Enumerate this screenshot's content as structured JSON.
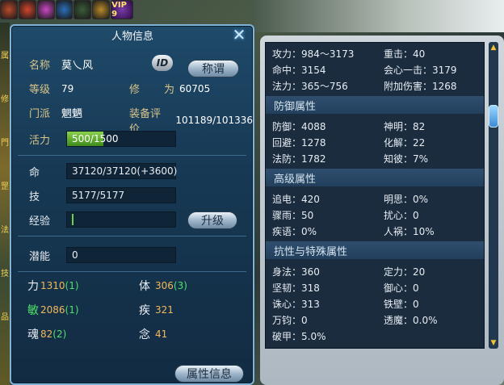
{
  "buffs": [
    {
      "icon": "red-demon-icon",
      "color": "#b84a2a"
    },
    {
      "icon": "fire-icon",
      "color": "#d0452c"
    },
    {
      "icon": "pink-gem-icon",
      "color": "#c848c2"
    },
    {
      "icon": "blue-wings-icon",
      "color": "#2a6fb8"
    },
    {
      "icon": "bird-icon",
      "color": "#3a5c3a"
    },
    {
      "icon": "gold-orb-icon",
      "color": "#b88a2a"
    }
  ],
  "vip_label": "VIP 9",
  "side_glyphs": [
    "属",
    "修",
    "門",
    "罡",
    "法",
    "技",
    "品"
  ],
  "panel": {
    "title": "人物信息",
    "close_glyph": "✕",
    "name_label": "名称",
    "name_value": "莫乀风",
    "id_badge": "ID",
    "title_button": "称谓",
    "level_label": "等级",
    "level_value": "79",
    "cultivation_label": "修",
    "cultivation_label2": "为",
    "cultivation_value": "60705",
    "sect_label": "门派",
    "sect_value": "魍魉",
    "equip_label": "装备评价",
    "equip_value": "101189/101336",
    "vitality_label": "活力",
    "vitality_value": "500/1500",
    "vitality_fraction": 0.333,
    "life_label": "命",
    "life_value": "37120/37120(+3600)",
    "skill_label": "技",
    "skill_value": "5177/5177",
    "exp_label": "经验",
    "exp_value": "",
    "upgrade_button": "升级",
    "potential_label": "潜能",
    "potential_value": "0",
    "attrs": [
      {
        "label": "力",
        "value": "1310",
        "bonus": "(1)",
        "label_color": "#e8edf3"
      },
      {
        "label": "体",
        "value": "306",
        "bonus": "(3)",
        "label_color": "#e8edf3"
      },
      {
        "label": "敏",
        "value": "2086",
        "bonus": "(1)",
        "label_color": "#4fe06a"
      },
      {
        "label": "疾",
        "value": "321",
        "bonus": "",
        "label_color": "#e8edf3"
      },
      {
        "label": "魂",
        "value": "82",
        "bonus": "(2)",
        "label_color": "#e8edf3"
      },
      {
        "label": "念",
        "value": "41",
        "bonus": "",
        "label_color": "#e8edf3"
      }
    ],
    "attr_info_button": "属性信息"
  },
  "right": {
    "top_rows": [
      {
        "l": "攻力：984～3173",
        "r": "重击：40"
      },
      {
        "l": "命中：3154",
        "r": "会心一击：3179"
      },
      {
        "l": "法力：365～756",
        "r": "附加伤害：1268"
      }
    ],
    "sections": [
      {
        "title": "防御属性",
        "rows": [
          {
            "l": "防御：4088",
            "r": "神明：82"
          },
          {
            "l": "回避：1278",
            "r": "化解：22"
          },
          {
            "l": "法防：1782",
            "r": "知彼：7%"
          }
        ]
      },
      {
        "title": "高级属性",
        "rows": [
          {
            "l": "追电：420",
            "r": "明思：0%"
          },
          {
            "l": "骤雨：50",
            "r": "扰心：0"
          },
          {
            "l": "疾语：0%",
            "r": "人祸：10%"
          }
        ]
      },
      {
        "title": "抗性与特殊属性",
        "rows": [
          {
            "l": "身法：360",
            "r": "定力：20"
          },
          {
            "l": "坚韧：318",
            "r": "御心：0"
          },
          {
            "l": "诛心：313",
            "r": "铁壁：0"
          },
          {
            "l": "万钧：0",
            "r": "透魔：0.0%"
          },
          {
            "l": "破甲：5.0%",
            "r": ""
          }
        ]
      }
    ],
    "scroll_up": "▲",
    "scroll_down": "▼"
  }
}
